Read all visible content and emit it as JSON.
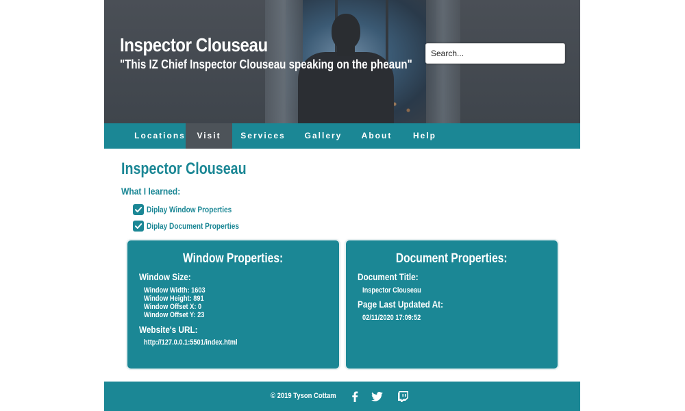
{
  "header": {
    "title": "Inspector Clouseau",
    "tagline": "\"This IZ Chief Inspector Clouseau speaking on the pheaun\"",
    "search_placeholder": "Search..."
  },
  "nav": {
    "items": [
      {
        "label": "Locations",
        "active": false
      },
      {
        "label": "Visit",
        "active": true
      },
      {
        "label": "Services",
        "active": false
      },
      {
        "label": "Gallery",
        "active": false
      },
      {
        "label": "About",
        "active": false
      },
      {
        "label": "Help",
        "active": false
      }
    ]
  },
  "main": {
    "title": "Inspector Clouseau",
    "learned_heading": "What I learned:",
    "checklist": [
      {
        "label": "Diplay Window Properties",
        "checked": true
      },
      {
        "label": "Diplay Document Properties",
        "checked": true
      }
    ]
  },
  "window_card": {
    "title": "Window Properties:",
    "size_heading": "Window Size:",
    "width": "Window Width: 1603",
    "height": "Window Height: 891",
    "offset_x": "Window Offset X: 0",
    "offset_y": "Window Offset Y: 23",
    "url_heading": "Website's URL:",
    "url": "http://127.0.0.1:5501/index.html"
  },
  "document_card": {
    "title": "Document Properties:",
    "doc_title_heading": "Document Title:",
    "doc_title": "Inspector Clouseau",
    "updated_heading": "Page Last Updated At:",
    "updated": "02/11/2020 17:09:52"
  },
  "footer": {
    "copyright": "© 2019 Tyson Cottam",
    "social": [
      "facebook-icon",
      "twitter-icon",
      "twitch-icon"
    ]
  },
  "colors": {
    "accent": "#1b8795",
    "nav_active": "#4d5359",
    "header_bg": "#454b52"
  }
}
